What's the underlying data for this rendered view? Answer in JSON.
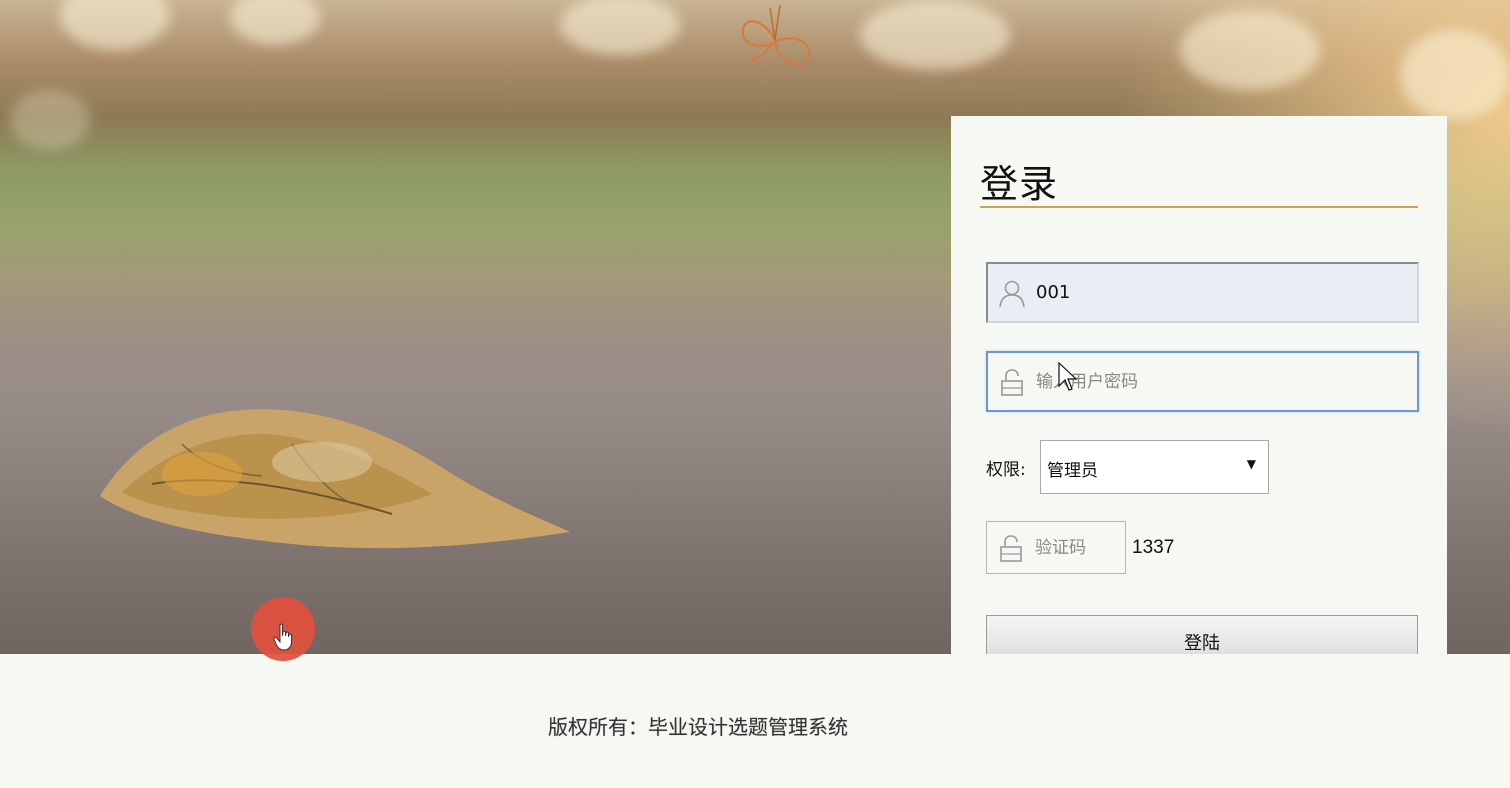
{
  "login": {
    "title": "登录",
    "username": {
      "value": "001",
      "icon": "user-icon"
    },
    "password": {
      "placeholder": "输入用户密码",
      "value": "",
      "icon": "lock-icon"
    },
    "role": {
      "label": "权限:",
      "selected": "管理员"
    },
    "captcha": {
      "placeholder": "验证码",
      "code": "1337",
      "icon": "lock-icon"
    },
    "submit_label": "登陆"
  },
  "footer": {
    "copyright": "版权所有：毕业设计选题管理系统"
  },
  "colors": {
    "accent_underline": "#d4a04a",
    "focus_border": "#6d96d6",
    "click_indicator": "#e1503c"
  }
}
